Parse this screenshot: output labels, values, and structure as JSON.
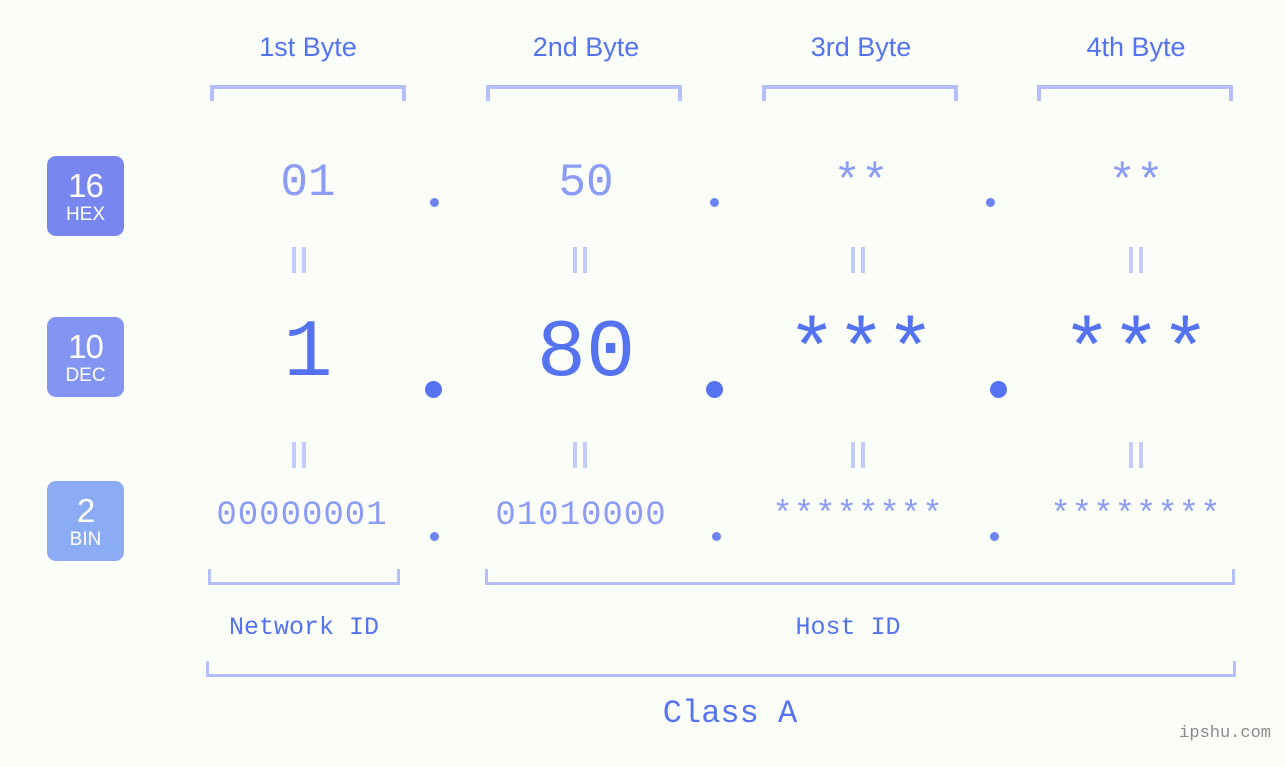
{
  "meta": {
    "watermark": "ipshu.com"
  },
  "byte_headers": [
    {
      "label": "1st Byte"
    },
    {
      "label": "2nd Byte"
    },
    {
      "label": "3rd Byte"
    },
    {
      "label": "4th Byte"
    }
  ],
  "radix_badges": [
    {
      "number": "16",
      "name": "HEX",
      "color": "#7886ef"
    },
    {
      "number": "10",
      "name": "DEC",
      "color": "#8494f3"
    },
    {
      "number": "2",
      "name": "BIN",
      "color": "#8cabf5"
    }
  ],
  "rows": {
    "hex": {
      "values": [
        "01",
        "50",
        "**",
        "**"
      ],
      "separators": [
        ".",
        ".",
        "."
      ]
    },
    "dec": {
      "values": [
        "1",
        "80",
        "***",
        "***"
      ],
      "separators": [
        ".",
        ".",
        "."
      ]
    },
    "bin": {
      "values": [
        "00000001",
        "01010000",
        "********",
        "********"
      ],
      "separators": [
        ".",
        ".",
        "."
      ]
    }
  },
  "equals_marks": {
    "symbol": "=",
    "count_per_row": 4
  },
  "sections": {
    "network_id": "Network ID",
    "host_id": "Host ID",
    "class": "Class A"
  },
  "colors": {
    "background": "#fbfdf8",
    "accent_strong": "#5573f0",
    "accent_light": "#8c9cf4",
    "bracket": "#b4bffb",
    "equals": "#c3cbfb",
    "watermark_text": "#8a8a8a"
  }
}
